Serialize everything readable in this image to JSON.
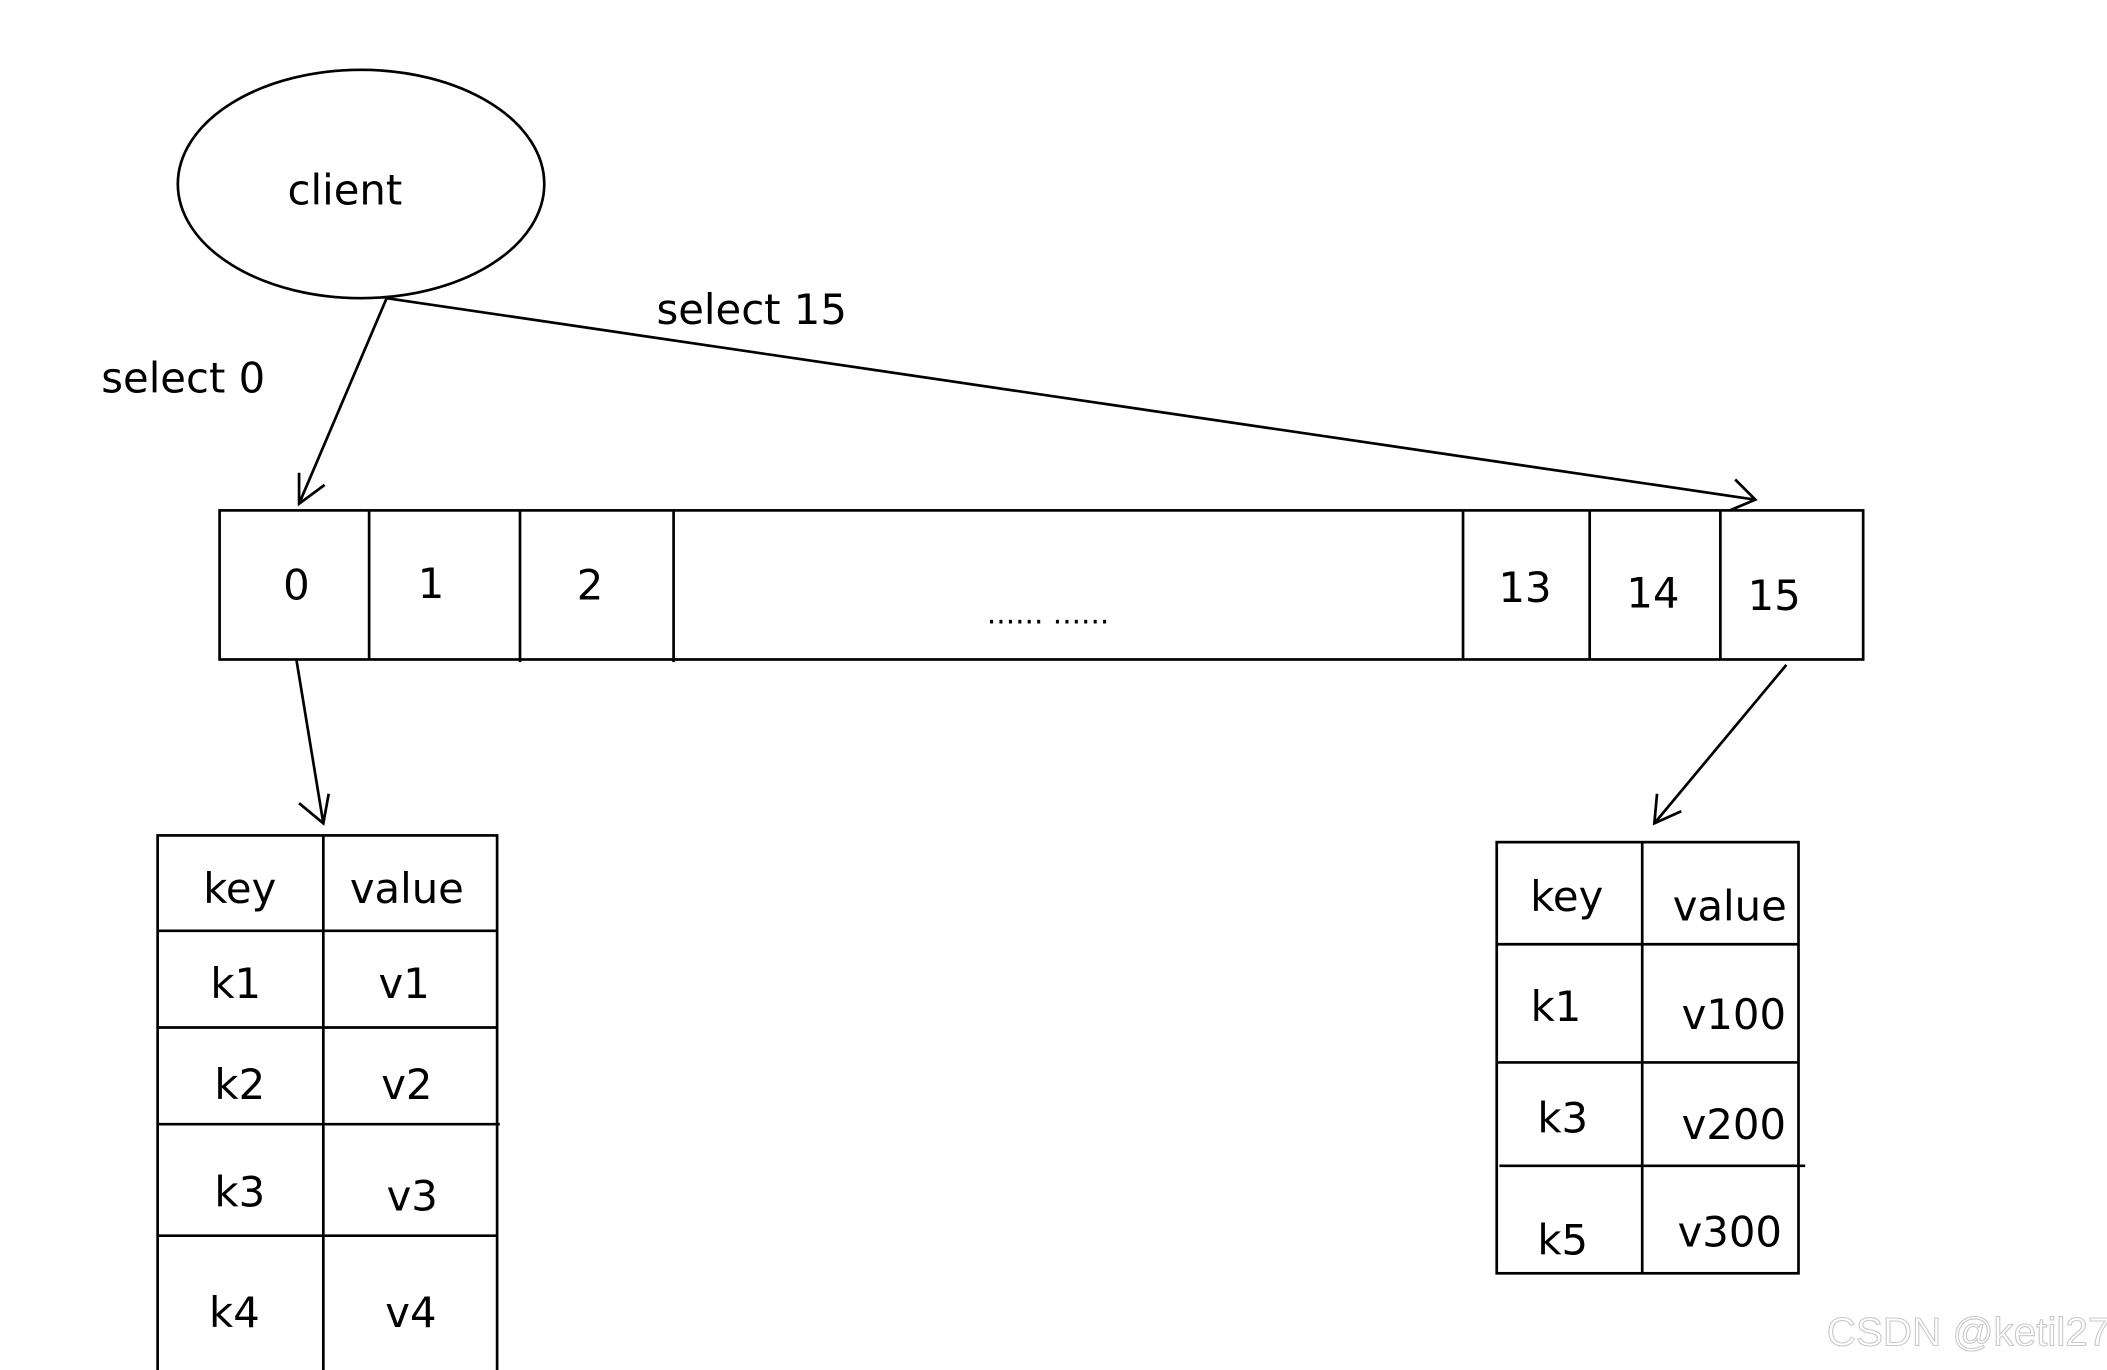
{
  "client": {
    "label": "client"
  },
  "edges": {
    "select_0": "select 0",
    "select_15": "select 15"
  },
  "array": {
    "cells": [
      "0",
      "1",
      "2",
      "...... ......",
      "13",
      "14",
      "15"
    ]
  },
  "left_table": {
    "headers": [
      "key",
      "value"
    ],
    "rows": [
      [
        "k1",
        "v1"
      ],
      [
        "k2",
        "v2"
      ],
      [
        "k3",
        "v3"
      ],
      [
        "k4",
        "v4"
      ]
    ]
  },
  "right_table": {
    "headers": [
      "key",
      "value"
    ],
    "rows": [
      [
        "k1",
        "v100"
      ],
      [
        "k3",
        "v200"
      ],
      [
        "k5",
        "v300"
      ]
    ]
  },
  "watermark": "CSDN @ketil27",
  "colors": {
    "stroke": "#000000",
    "background": "#ffffff",
    "watermark": "#c8c8c8"
  }
}
